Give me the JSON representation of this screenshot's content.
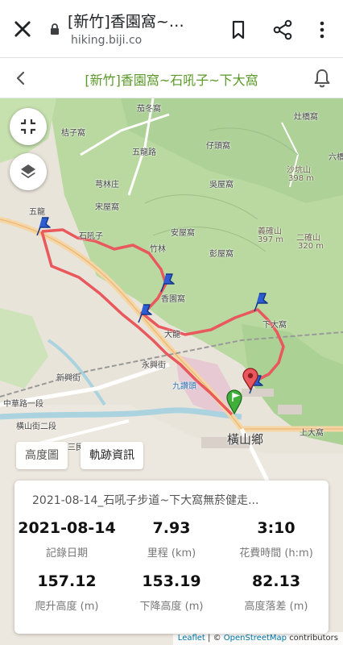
{
  "browser": {
    "page_title": "[新竹]香園窩~…",
    "url": "hiking.biji.co",
    "icons": [
      "close-icon",
      "lock-icon",
      "bookmark-icon",
      "share-icon",
      "more-vert-icon"
    ]
  },
  "header": {
    "title": "[新竹]香園窩~石吼子~下大窩",
    "accent_color": "#5b9a29",
    "icons": [
      "back-chevron-icon",
      "bell-icon"
    ]
  },
  "map": {
    "route_color": "#e8585c",
    "place_labels": {
      "hsiang_yuan_wo": "茄冬窩",
      "kui_tzu": "桔子窩",
      "tsai_tou": "仔頭窩",
      "chin_hsing": "灶橋窩",
      "liu_shan": "六橋",
      "chu_lin": "芎林庄",
      "sung_tzu": "宋屋窩",
      "wu_ku": "吳屋窩",
      "sha_keng": "沙坑山",
      "sha_keng_elev": "398 m",
      "wu_lung": "五龍",
      "shih_hou": "石吼子",
      "an_wu": "安屋窩",
      "peng_wu": "彭屋窩",
      "yi_hsing": "義確山",
      "yi_hsing_elev": "397 m",
      "er_chieh": "二確山",
      "er_chieh_elev": "320 m",
      "hsiang_yuan": "香園窩",
      "ta_lung": "大龍",
      "hsia_ta": "下大窩",
      "yung_hsing": "永興街",
      "chiu_tsan": "九讚頭",
      "chung_hua": "中華路一段",
      "hsin_hsing": "新興街",
      "heng_shan_road": "橫山街二段",
      "san_chieh": "三民路",
      "shang_ta": "上大窩",
      "hsi_lu": "五龍路",
      "pu_ai": "竹林",
      "town": "橫山鄉"
    },
    "controls": {
      "fullscreen_icon": "exit-fullscreen-icon",
      "layers_icon": "layers-icon"
    },
    "markers": [
      "waypoint-pin-icon",
      "start-pin-icon",
      "end-pin-icon"
    ],
    "attribution": {
      "leaflet": "Leaflet",
      "separator": "| ©",
      "osm": "OpenStreetMap",
      "suffix": "contributors"
    }
  },
  "tabs": {
    "elevation": "高度圖",
    "track_info": "軌跡資訊"
  },
  "stats": {
    "track_title": "2021-08-14_石吼子步道~下大窩無菸健走...",
    "date_value": "2021-08-14",
    "date_label": "記錄日期",
    "distance_value": "7.93",
    "distance_label": "里程 (km)",
    "time_value": "3:10",
    "time_label": "花費時間 (h:m)",
    "ascent_value": "157.12",
    "ascent_label": "爬升高度 (m)",
    "descent_value": "153.19",
    "descent_label": "下降高度 (m)",
    "drop_value": "82.13",
    "drop_label": "高度落差 (m)"
  }
}
